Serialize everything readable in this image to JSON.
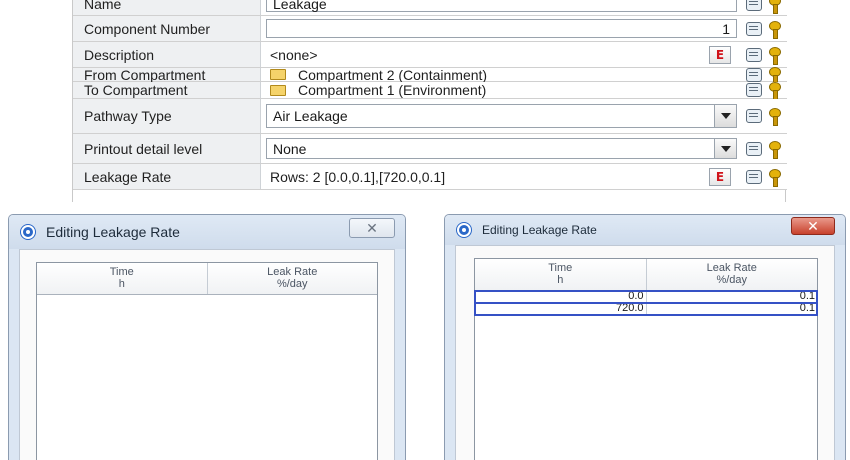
{
  "properties": {
    "rows": [
      {
        "label": "Name",
        "value": "Leakage",
        "kind": "text"
      },
      {
        "label": "Component Number",
        "value": "1",
        "kind": "number"
      },
      {
        "label": "Description",
        "value": "<none>",
        "kind": "editor"
      },
      {
        "label": "From Compartment",
        "value": "Compartment 2 (Containment)",
        "kind": "link",
        "icon": "folder-icon"
      },
      {
        "label": "To Compartment",
        "value": "Compartment 1 (Environment)",
        "kind": "link",
        "icon": "folder-icon"
      },
      {
        "label": "Pathway Type",
        "value": "Air Leakage",
        "kind": "combo"
      },
      {
        "label": "Printout detail level",
        "value": "None",
        "kind": "combo"
      },
      {
        "label": "Leakage Rate",
        "value": "Rows: 2 [0.0,0.1],[720.0,0.1]",
        "kind": "editor"
      }
    ],
    "edit_button_glyph": "E",
    "row_icons": [
      "note-icon",
      "key-icon"
    ]
  },
  "dialog_empty": {
    "title": "Editing Leakage Rate",
    "close_glyph": "✕",
    "columns": [
      {
        "name": "Time",
        "unit": "h"
      },
      {
        "name": "Leak Rate",
        "unit": "%/day"
      }
    ],
    "rows": []
  },
  "dialog_filled": {
    "title": "Editing Leakage Rate",
    "close_glyph": "✕",
    "columns": [
      {
        "name": "Time",
        "unit": "h"
      },
      {
        "name": "Leak Rate",
        "unit": "%/day"
      }
    ],
    "rows": [
      {
        "time": "0.0",
        "rate": "0.1"
      },
      {
        "time": "720.0",
        "rate": "0.1"
      }
    ]
  },
  "colors": {
    "accent_blue": "#2b68c8",
    "edit_red": "#d0131a",
    "selection": "#3551c5",
    "close_red": "#c8412c"
  }
}
